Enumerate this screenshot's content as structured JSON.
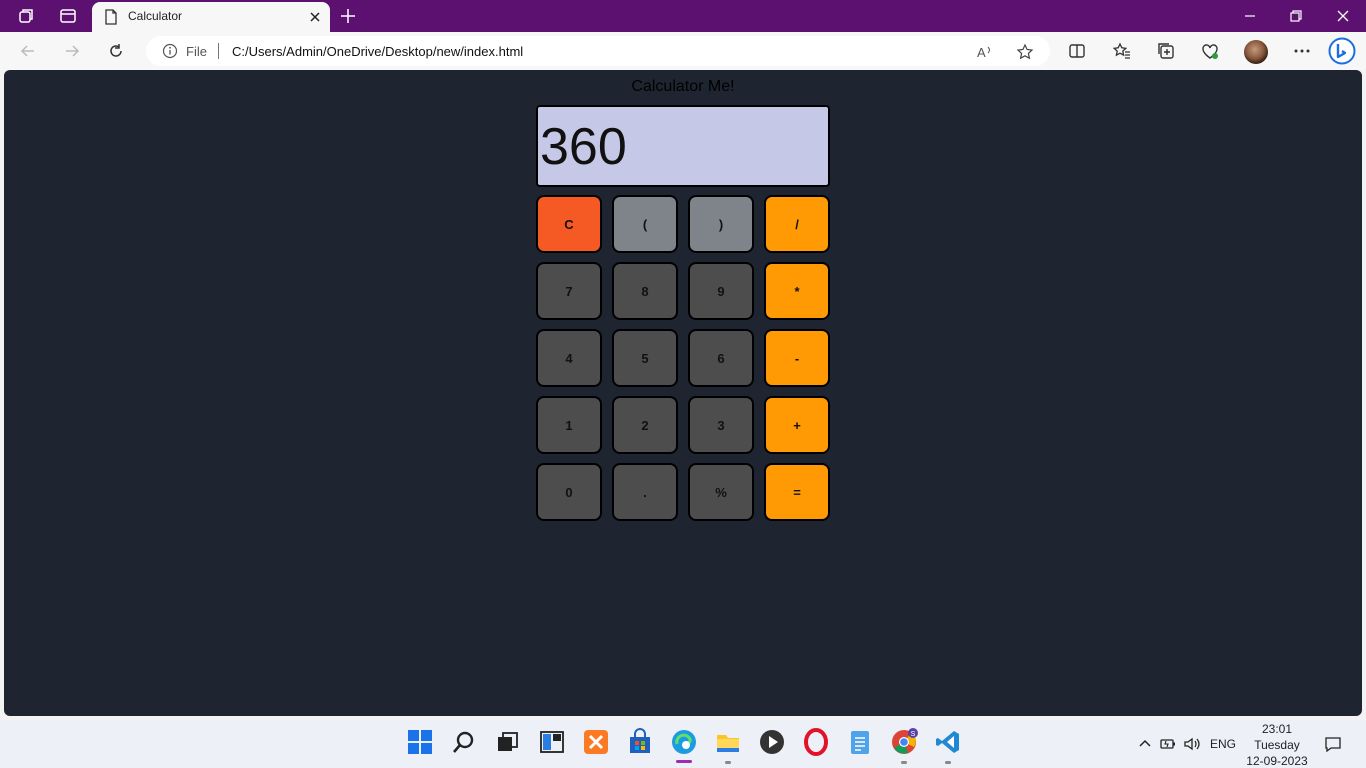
{
  "browser": {
    "tab_title": "Calculator",
    "address_prefix": "File",
    "url": "C:/Users/Admin/OneDrive/Desktop/new/index.html"
  },
  "page": {
    "heading": "Calculator Me!",
    "display_value": "360",
    "keys": [
      {
        "label": "C",
        "kind": "clear"
      },
      {
        "label": "(",
        "kind": "paren"
      },
      {
        "label": ")",
        "kind": "paren"
      },
      {
        "label": "/",
        "kind": "op"
      },
      {
        "label": "7",
        "kind": "num"
      },
      {
        "label": "8",
        "kind": "num"
      },
      {
        "label": "9",
        "kind": "num"
      },
      {
        "label": "*",
        "kind": "op"
      },
      {
        "label": "4",
        "kind": "num"
      },
      {
        "label": "5",
        "kind": "num"
      },
      {
        "label": "6",
        "kind": "num"
      },
      {
        "label": "-",
        "kind": "op"
      },
      {
        "label": "1",
        "kind": "num"
      },
      {
        "label": "2",
        "kind": "num"
      },
      {
        "label": "3",
        "kind": "num"
      },
      {
        "label": "+",
        "kind": "op"
      },
      {
        "label": "0",
        "kind": "num"
      },
      {
        "label": ".",
        "kind": "num"
      },
      {
        "label": "%",
        "kind": "num"
      },
      {
        "label": "=",
        "kind": "op"
      }
    ]
  },
  "taskbar": {
    "language": "ENG",
    "time": "23:01",
    "day": "Tuesday",
    "date": "12-09-2023",
    "apps": [
      "start",
      "search",
      "task-view",
      "widgets",
      "xampp",
      "microsoft-store",
      "edge",
      "file-explorer",
      "media-player",
      "opera",
      "notepad",
      "chrome",
      "vscode"
    ]
  },
  "colors": {
    "titlebar": "#5c1070",
    "page_background": "#1e2530",
    "display_background": "#c6c8e8",
    "key_number": "#4d4d4d",
    "key_operator": "#ff9a05",
    "key_clear": "#f55a24",
    "key_paren": "#7f848a"
  }
}
